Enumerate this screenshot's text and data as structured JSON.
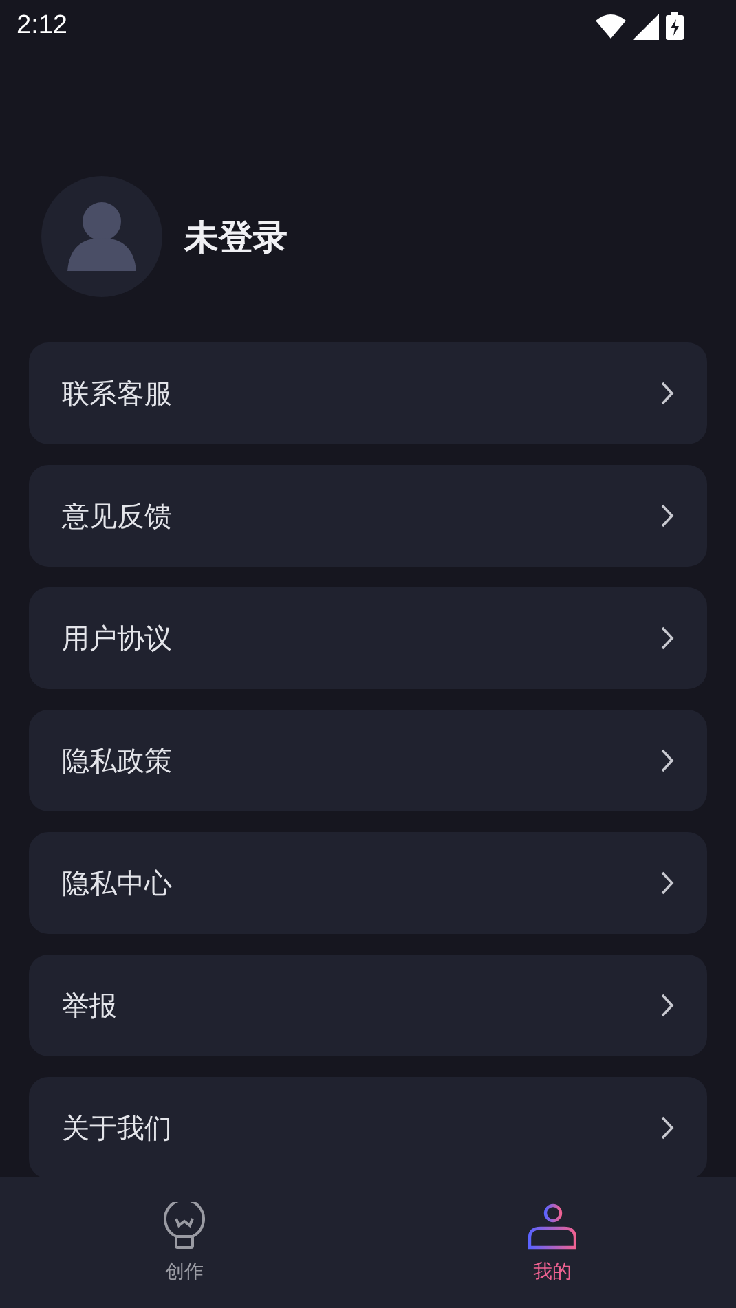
{
  "status_bar": {
    "time": "2:12"
  },
  "profile": {
    "name": "未登录"
  },
  "menu": [
    {
      "label": "联系客服"
    },
    {
      "label": "意见反馈"
    },
    {
      "label": "用户协议"
    },
    {
      "label": "隐私政策"
    },
    {
      "label": "隐私中心"
    },
    {
      "label": "举报"
    },
    {
      "label": "关于我们"
    }
  ],
  "tab_bar": [
    {
      "label": "创作",
      "kind": "create",
      "selected": false
    },
    {
      "label": "我的",
      "kind": "profile",
      "selected": true
    }
  ]
}
